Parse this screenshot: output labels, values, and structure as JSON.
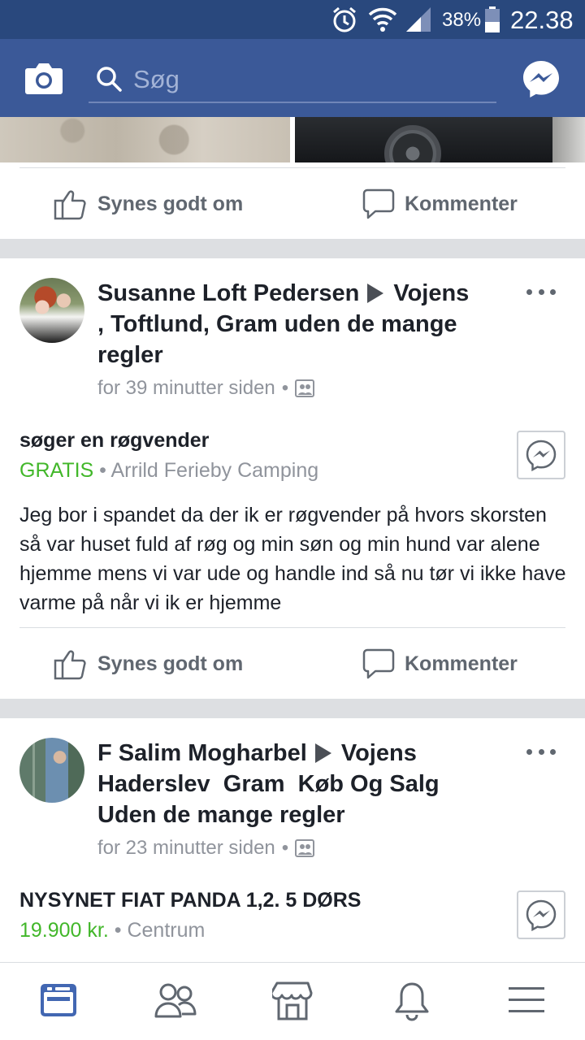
{
  "status_bar": {
    "battery_percent": "38%",
    "time": "22.38",
    "icons": [
      "alarm-icon",
      "wifi-icon",
      "signal-icon",
      "battery-icon"
    ]
  },
  "header": {
    "search_placeholder": "Søg",
    "icons": [
      "camera-icon",
      "search-icon",
      "messenger-icon"
    ]
  },
  "actions": {
    "like_label": "Synes godt om",
    "comment_label": "Kommenter"
  },
  "posts": [
    {
      "author": "Susanne Loft Pedersen",
      "group": "Vojens , Toftlund, Gram uden de mange regler",
      "time": "for 39 minutter siden",
      "title": "søger en røgvender",
      "price": "GRATIS",
      "location": "Arrild Ferieby Camping",
      "text": "Jeg bor i spandet da der ik er røgvender på hvors skorsten så var huset fuld af røg og min søn og min hund var alene hjemme mens vi var ude og handle ind så nu tør vi ikke have varme på når vi ik er hjemme"
    },
    {
      "author": "F Salim Mogharbel",
      "group": "Vojens  Haderslev  Gram  Køb Og Salg  Uden de mange regler",
      "group_lead": "Vojens",
      "group_rest": "Haderslev  Gram  Køb Og Salg Uden de mange regler",
      "time": "for 23 minutter siden",
      "title": "NYSYNET FIAT PANDA 1,2. 5 DØRS",
      "price": "19.900 kr.",
      "location": "Centrum"
    }
  ],
  "bottom_nav": [
    "news-feed-icon",
    "friends-icon",
    "marketplace-icon",
    "notifications-icon",
    "menu-icon"
  ],
  "colors": {
    "status_bar": "#29487d",
    "header": "#3b5998",
    "accent": "#4267b2",
    "price_green": "#42b72a",
    "feed_bg": "#dddfe2"
  }
}
